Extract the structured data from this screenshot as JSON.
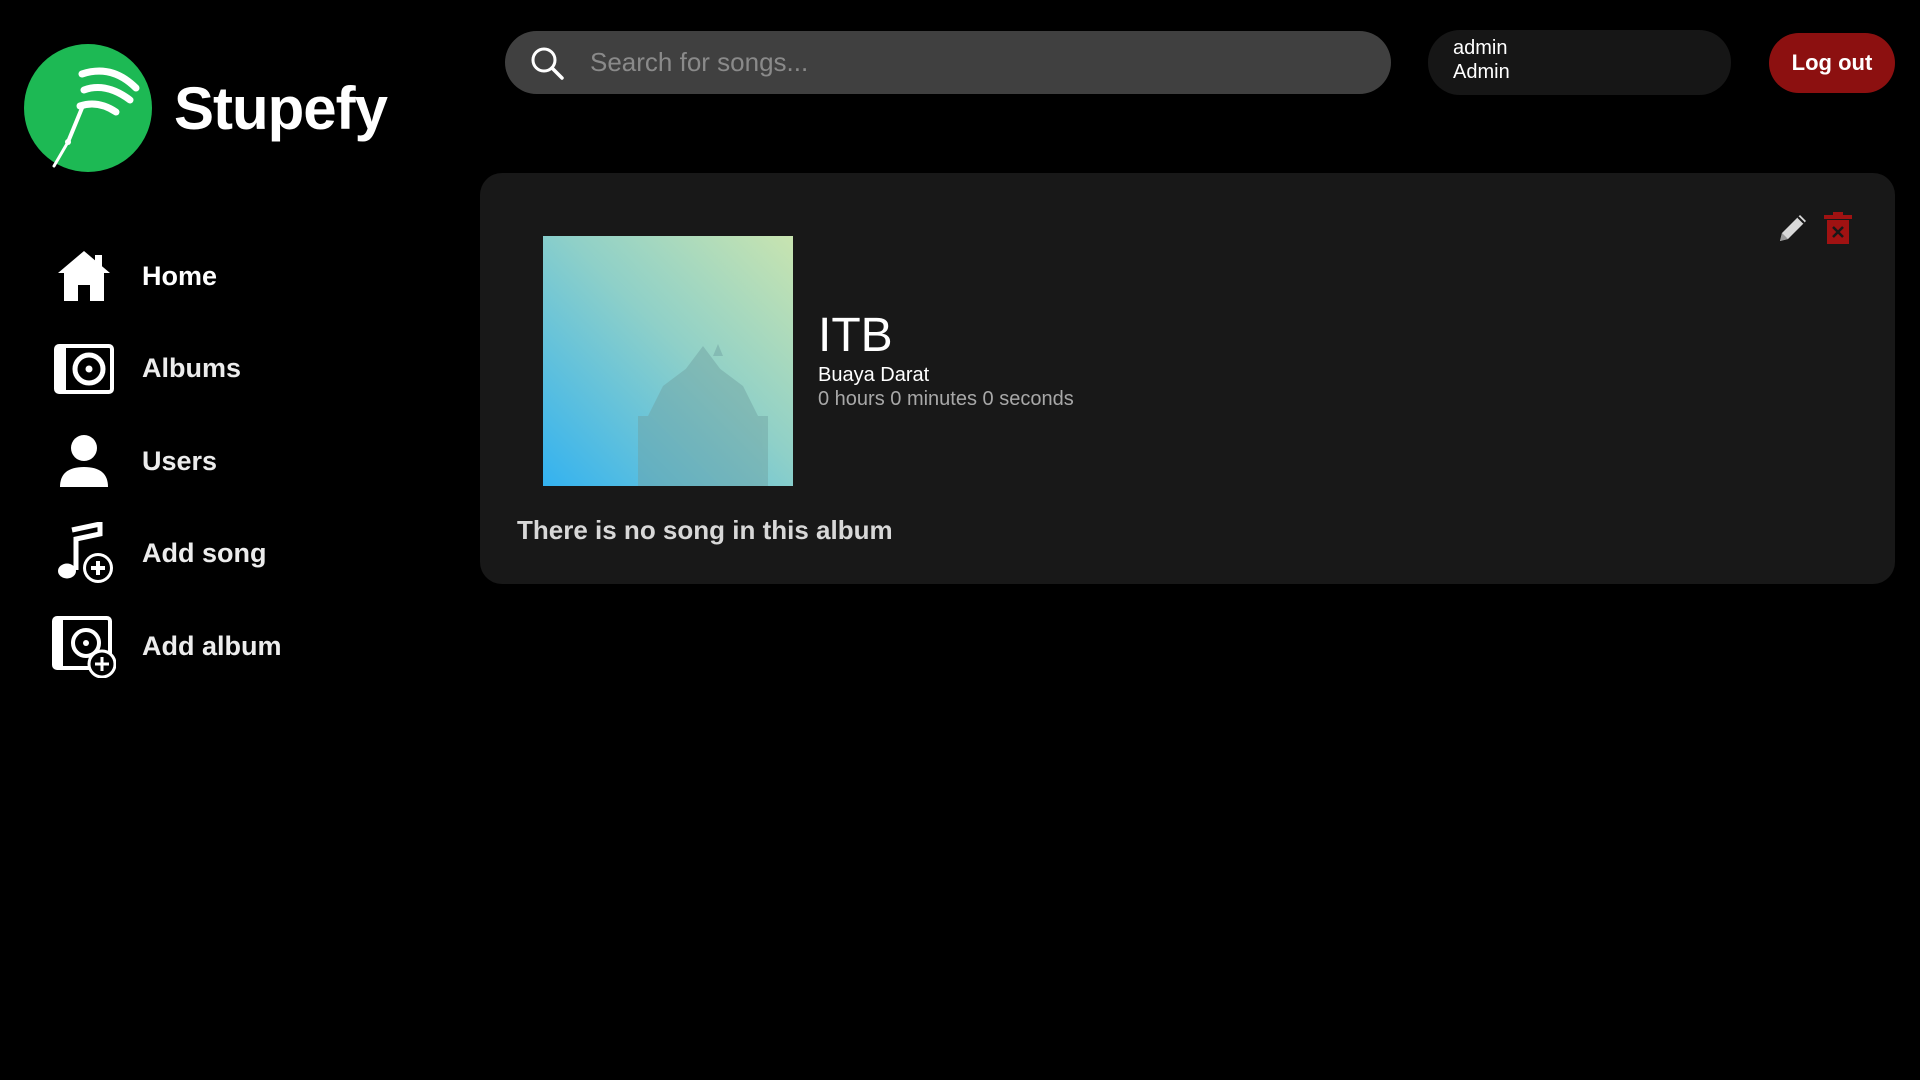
{
  "app": {
    "name": "Stupefy"
  },
  "colors": {
    "accent": "#1DB954",
    "danger": "#8c1010",
    "background": "#000000",
    "card": "#181818"
  },
  "sidebar": {
    "items": [
      {
        "label": "Home",
        "icon": "home-icon"
      },
      {
        "label": "Albums",
        "icon": "album-icon"
      },
      {
        "label": "Users",
        "icon": "user-icon"
      },
      {
        "label": "Add song",
        "icon": "add-song-icon"
      },
      {
        "label": "Add album",
        "icon": "add-album-icon"
      }
    ]
  },
  "search": {
    "placeholder": "Search for songs...",
    "value": ""
  },
  "user": {
    "username": "admin",
    "role": "Admin"
  },
  "header": {
    "logout_label": "Log out"
  },
  "album": {
    "title": "ITB",
    "artist": "Buaya Darat",
    "duration": "0 hours 0 minutes 0 seconds",
    "empty_message": "There is no song in this album",
    "actions": [
      "pencil-icon",
      "trash-icon"
    ]
  }
}
